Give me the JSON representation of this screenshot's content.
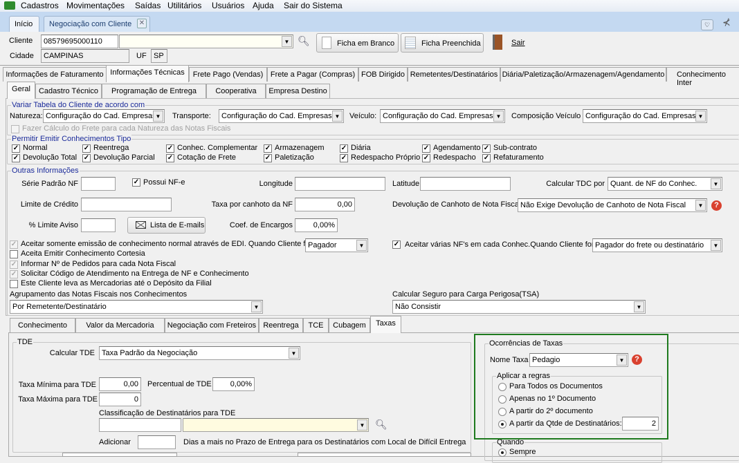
{
  "menu": {
    "items": [
      "Cadastros",
      "Movimentações",
      "Saídas",
      "Utilitários",
      "Usuários",
      "Ajuda",
      "Sair do Sistema"
    ]
  },
  "doc_tabs": [
    {
      "label": "Início"
    },
    {
      "label": "Negociação com Cliente",
      "active": true
    }
  ],
  "header": {
    "cliente_label": "Cliente",
    "cliente_code": "08579695000110",
    "cliente_name": "",
    "cidade_label": "Cidade",
    "cidade": "CAMPINAS",
    "uf_label": "UF",
    "uf": "SP",
    "ficha_branco": "Ficha em Branco",
    "ficha_preenchida": "Ficha Preenchida",
    "sair": "Sair"
  },
  "main_tabs": [
    "Informações de Faturamento",
    "Informações Técnicas",
    "Frete Pago (Vendas)",
    "Frete a Pagar (Compras)",
    "FOB Dirigido",
    "Remetentes/Destinatários",
    "Diária/Paletização/Armazenagem/Agendamento",
    "Conhecimento Inter"
  ],
  "main_tab_active": "Informações Técnicas",
  "sub_tabs": [
    "Geral",
    "Cadastro Técnico",
    "Programação de Entrega",
    "Cooperativa",
    "Empresa Destino"
  ],
  "variar": {
    "legend": "Variar Tabela do Cliente de acordo com",
    "natureza_label": "Natureza:",
    "natureza": "Configuração do Cad. Empresas",
    "transporte_label": "Transporte:",
    "transporte": "Configuração do Cad. Empresas",
    "veiculo_label": "Veículo:",
    "veiculo": "Configuração do Cad. Empresas",
    "composicao_label": "Composição Veículo",
    "composicao": "Configuração do Cad. Empresas",
    "fazer_calculo": "Fazer Cálculo do Frete para cada Natureza das Notas Fiscais",
    "fazer_calculo_checked": false
  },
  "permitir": {
    "legend": "Permitir Emitir Conhecimentos Tipo",
    "items": [
      {
        "label": "Normal",
        "checked": true
      },
      {
        "label": "Reentrega",
        "checked": true
      },
      {
        "label": "Conhec. Complementar",
        "checked": true
      },
      {
        "label": "Armazenagem",
        "checked": true
      },
      {
        "label": "Diária",
        "checked": true
      },
      {
        "label": "Agendamento",
        "checked": true
      },
      {
        "label": "Sub-contrato",
        "checked": true
      },
      {
        "label": "Devolução Total",
        "checked": true
      },
      {
        "label": "Devolução Parcial",
        "checked": true
      },
      {
        "label": "Cotação de Frete",
        "checked": true
      },
      {
        "label": "Paletização",
        "checked": true
      },
      {
        "label": "Redespacho Próprio",
        "checked": true
      },
      {
        "label": "Redespacho",
        "checked": true
      },
      {
        "label": "Refaturamento",
        "checked": true
      }
    ]
  },
  "outras": {
    "legend": "Outras Informações",
    "serie_label": "Série Padrão NF",
    "serie": "",
    "possui_nfe": "Possui NF-e",
    "possui_nfe_checked": true,
    "longitude_label": "Longitude",
    "longitude": "",
    "latitude_label": "Latitude",
    "latitude": "",
    "calc_tdc_label": "Calcular TDC por",
    "calc_tdc": "Quant. de NF do Conhec.",
    "limite_label": "Limite de Crédito",
    "limite": "",
    "taxa_canhoto_label": "Taxa por canhoto da NF",
    "taxa_canhoto": "0,00",
    "devolucao_label": "Devolução de Canhoto de Nota Fiscal",
    "devolucao": "Não Exige Devolução de Canhoto de Nota Fiscal",
    "limite_aviso_label": "% Limite Aviso",
    "limite_aviso": "",
    "lista_emails": "Lista de E-mails",
    "coef_label": "Coef. de Encargos",
    "coef": "0,00%",
    "checks": [
      {
        "label": "Aceitar somente emissão de conhecimento normal através de EDI. Quando Cliente for",
        "checked": true,
        "disabled": true
      },
      {
        "label": "Aceita Emitir Conhecimento Cortesia",
        "checked": false
      },
      {
        "label": "Informar Nº de Pedidos para cada Nota Fiscal",
        "checked": true,
        "disabled": true
      },
      {
        "label": "Solicitar Código de Atendimento na Entrega de NF e Conhecimento",
        "checked": true,
        "disabled": true
      },
      {
        "label": "Este Cliente leva as Mercadorias até o Depósito da Filial",
        "checked": false
      }
    ],
    "edi_quando": "Pagador",
    "aceitar_varias": "Aceitar várias NF's em cada Conhec.Quando Cliente for",
    "aceitar_varias_checked": true,
    "aceitar_varias_quando": "Pagador do frete ou destinatário",
    "agrupamento_label": "Agrupamento das Notas Fiscais nos Conhecimentos",
    "agrupamento": "Por Remetente/Destinatário",
    "seguro_label": "Calcular Seguro para Carga Perigosa(TSA)",
    "seguro": "Não Consistir"
  },
  "lower_tabs": [
    "Conhecimento",
    "Valor da Mercadoria",
    "Negociação com Freteiros",
    "Reentrega",
    "TCE",
    "Cubagem",
    "Taxas"
  ],
  "lower_tab_active": "Taxas",
  "tde": {
    "legend": "TDE",
    "calc_label": "Calcular TDE",
    "calc": "Taxa Padrão da Negociação",
    "minima_label": "Taxa Mínima para TDE",
    "minima": "0,00",
    "percentual_label": "Percentual de TDE",
    "percentual": "0,00%",
    "maxima_label": "Taxa Máxima para TDE",
    "maxima": "0",
    "classificacao_label": "Classificação de Destinatários para TDE",
    "classificacao_code": "",
    "classificacao_name": "",
    "adicionar_label": "Adicionar",
    "adicionar": "",
    "dias_text": "Dias  a mais no Prazo de Entrega para os Destinatários com Local de Difícil Entrega"
  },
  "ocorrencias": {
    "legend": "Ocorrências de Taxas",
    "nome_label": "Nome Taxa",
    "nome": "Pedagio",
    "aplicar_legend": "Aplicar a regras",
    "options": [
      {
        "label": "Para Todos os Documentos",
        "selected": false
      },
      {
        "label": "Apenas no 1º Documento",
        "selected": false
      },
      {
        "label": "A partir do 2º documento",
        "selected": false
      },
      {
        "label": "A partir da Qtde de Destinatários:",
        "selected": true
      }
    ],
    "qtde": "2",
    "quando_legend": "Quando",
    "quando_sempre": "Sempre",
    "quando_sempre_selected": true,
    "highlight_color": "#1e7a1e"
  }
}
